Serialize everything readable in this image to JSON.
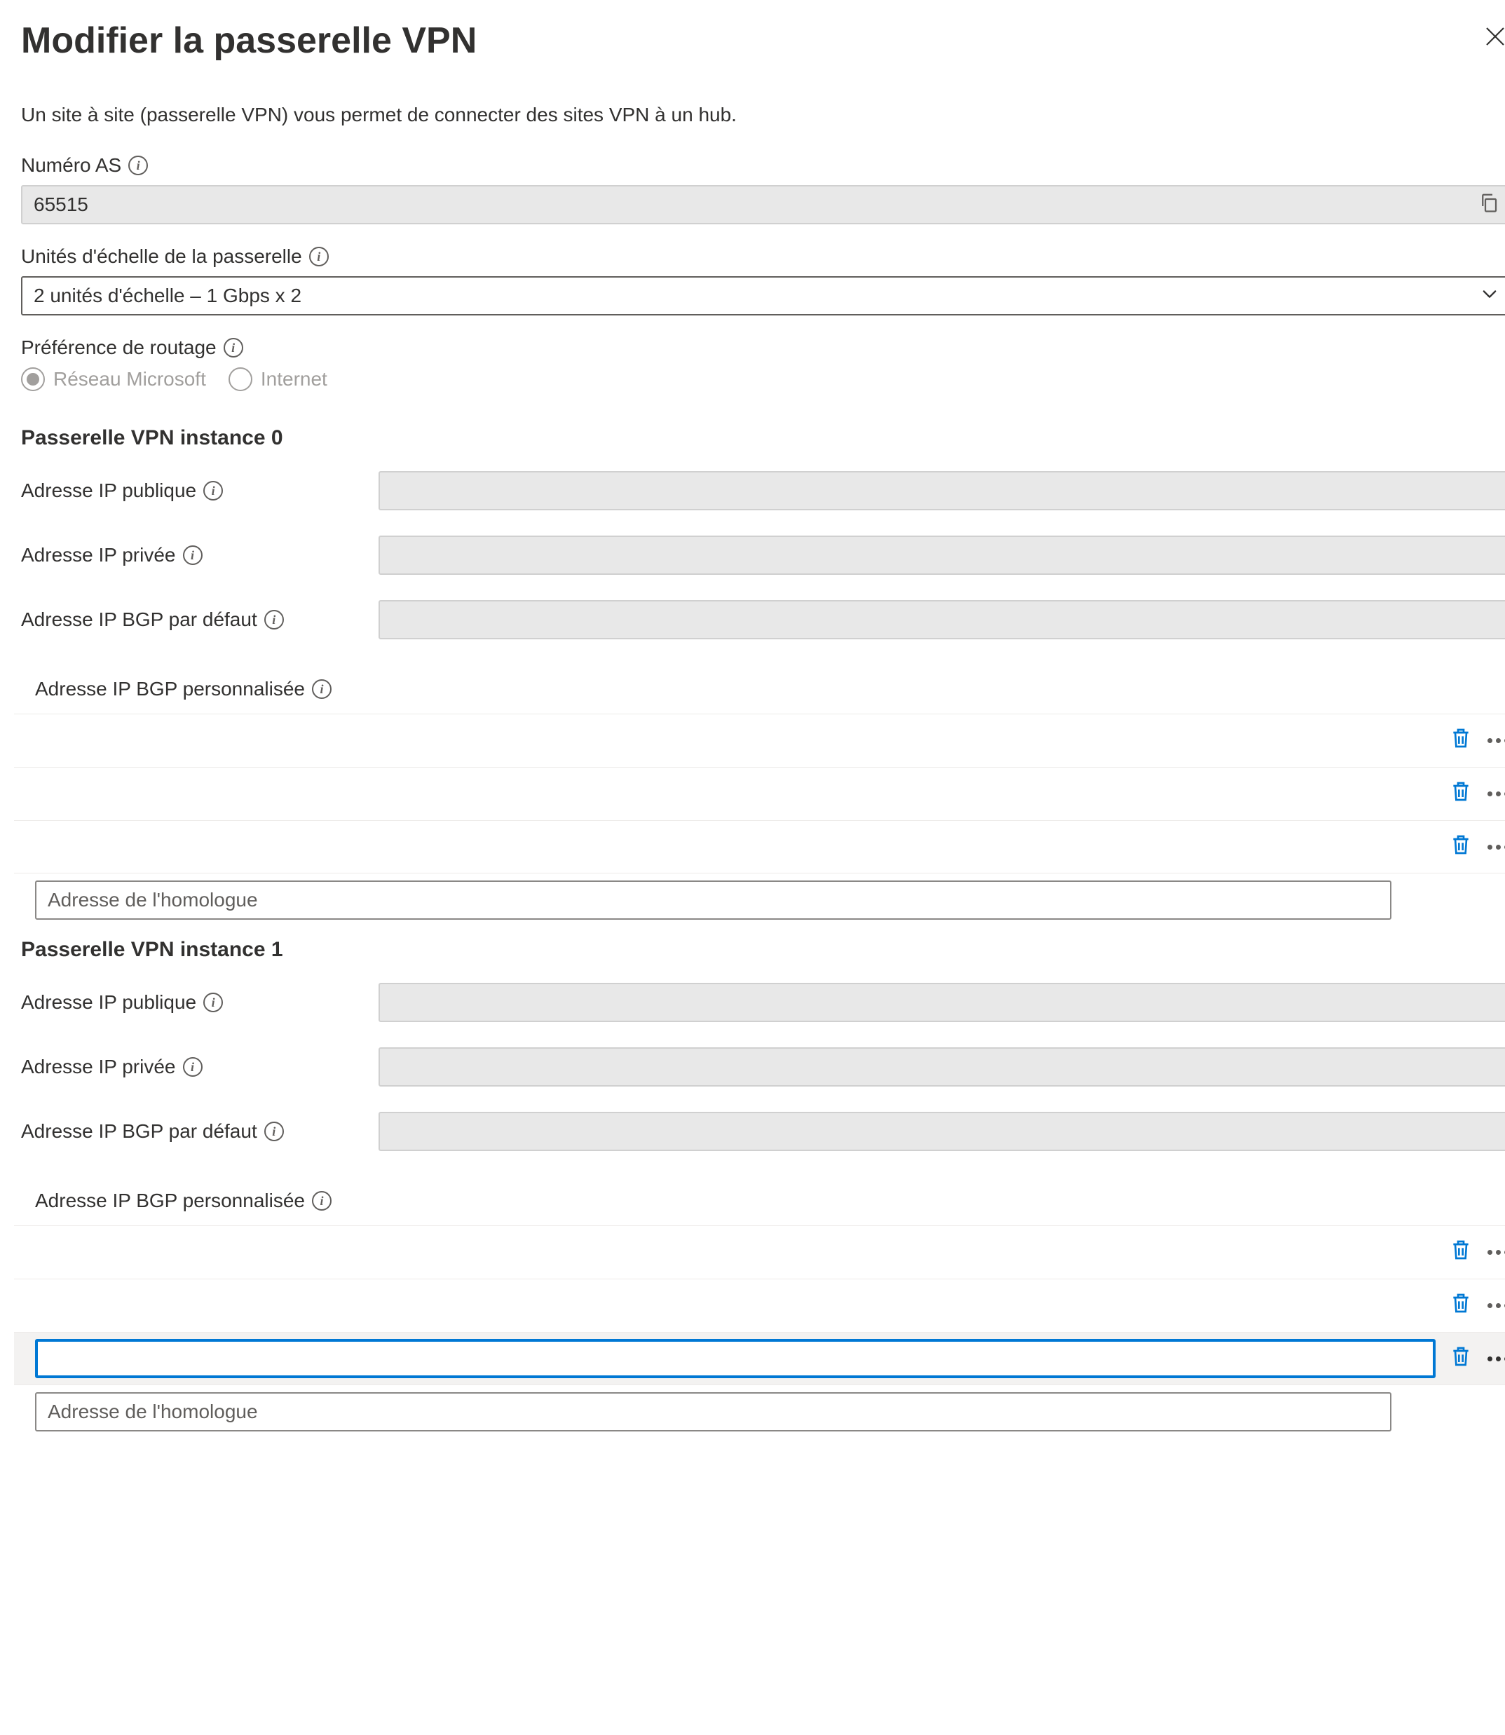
{
  "header": {
    "title": "Modifier la passerelle VPN"
  },
  "description": "Un site à site (passerelle VPN) vous permet de connecter des sites VPN à un hub.",
  "asNumber": {
    "label": "Numéro AS",
    "value": "65515"
  },
  "scaleUnits": {
    "label": "Unités d'échelle de la passerelle",
    "value": "2 unités d'échelle – 1 Gbps x 2"
  },
  "routingPref": {
    "label": "Préférence de routage",
    "options": [
      "Réseau Microsoft",
      "Internet"
    ],
    "selected": "Réseau Microsoft"
  },
  "instances": [
    {
      "heading": "Passerelle VPN instance 0",
      "publicIpLabel": "Adresse IP publique",
      "privateIpLabel": "Adresse IP privée",
      "defaultBgpLabel": "Adresse IP BGP par défaut",
      "customBgpLabel": "Adresse IP BGP personnalisée",
      "peerPlaceholder": "Adresse de l'homologue"
    },
    {
      "heading": "Passerelle VPN instance 1",
      "publicIpLabel": "Adresse IP publique",
      "privateIpLabel": "Adresse IP privée",
      "defaultBgpLabel": "Adresse IP BGP par défaut",
      "customBgpLabel": "Adresse IP BGP personnalisée",
      "peerPlaceholder": "Adresse de l'homologue"
    }
  ]
}
